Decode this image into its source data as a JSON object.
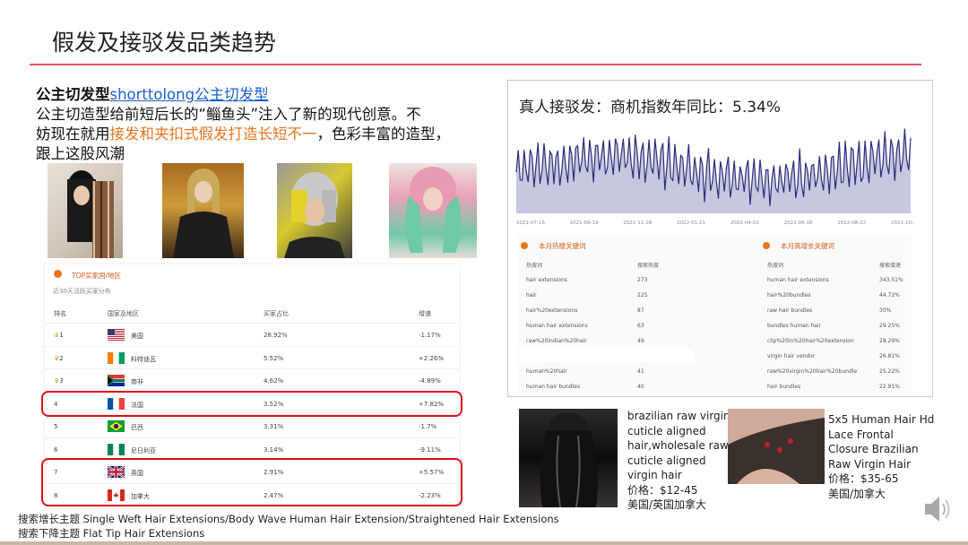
{
  "title": "假发及接驳发品类趋势",
  "intro": {
    "title_bold": "公主切发型",
    "title_link": "shorttolong公主切发型",
    "line1": "公主切造型给前短后长的“鲻鱼头”注入了新的现代创意。不",
    "line2_before": "妨现在就用",
    "line2_highlight": "接发和夹扣式假发打造长短不一",
    "line2_after": "，色彩丰富的造型，",
    "line3": "跟上这股风潮"
  },
  "ranking": {
    "heading": "TOP买家国/地区",
    "subheading": "近30天活跃买家分布",
    "columns": [
      "排名",
      "国家及地区",
      "买家占比",
      "增速"
    ],
    "rows": [
      {
        "rank": "1",
        "crown": true,
        "flag": "us",
        "country": "美国",
        "share": "28.92%",
        "growth": "-1.17%"
      },
      {
        "rank": "2",
        "crown": true,
        "flag": "ci",
        "country": "科特迪瓦",
        "share": "5.52%",
        "growth": "+2.26%"
      },
      {
        "rank": "3",
        "crown": true,
        "flag": "za",
        "country": "南非",
        "share": "4.62%",
        "growth": "-4.89%"
      },
      {
        "rank": "4",
        "crown": false,
        "flag": "fr",
        "country": "法国",
        "share": "3.52%",
        "growth": "+7.82%"
      },
      {
        "rank": "5",
        "crown": false,
        "flag": "br",
        "country": "巴西",
        "share": "3.31%",
        "growth": "-1.7%"
      },
      {
        "rank": "6",
        "crown": false,
        "flag": "ng",
        "country": "尼日利亚",
        "share": "3.14%",
        "growth": "-9.11%"
      },
      {
        "rank": "7",
        "crown": false,
        "flag": "gb",
        "country": "英国",
        "share": "2.91%",
        "growth": "+5.57%"
      },
      {
        "rank": "8",
        "crown": false,
        "flag": "ca",
        "country": "加拿大",
        "share": "2.47%",
        "growth": "-2.23%"
      }
    ]
  },
  "trend": {
    "title": "真人接驳发：商机指数年同比：5.34%",
    "x_ticks": [
      "2021-07-16",
      "2021-09-19",
      "2021-11-28",
      "2022-01-21",
      "2022-04-02",
      "2022-06-16",
      "2022-08-22",
      "2022-10-29"
    ]
  },
  "hot_keywords": {
    "heading": "本月热搜关键词",
    "col1": "热搜词",
    "col2": "搜索热度",
    "rows": [
      {
        "term": "hair extensions",
        "value": "273"
      },
      {
        "term": "hair",
        "value": "225"
      },
      {
        "term": "hair%20extensions",
        "value": "87"
      },
      {
        "term": "human hair extensions",
        "value": "63"
      },
      {
        "term": "raw%20indian%20hair",
        "value": "49"
      },
      {
        "term": "human%20hair",
        "value": "41"
      },
      {
        "term": "human hair bundles",
        "value": "40"
      }
    ]
  },
  "growth_keywords": {
    "heading": "本月高增长关键词",
    "col1": "热搜词",
    "col2": "搜索增速",
    "rows": [
      {
        "term": "human hair extensions",
        "value": "343.51%"
      },
      {
        "term": "hair%20bundles",
        "value": "44.72%"
      },
      {
        "term": "raw hair bundles",
        "value": "30%"
      },
      {
        "term": "bundles human hair",
        "value": "29.25%"
      },
      {
        "term": "clip%20in%20hair%20extension",
        "value": "28.29%"
      },
      {
        "term": "virgin hair vendor",
        "value": "26.81%"
      },
      {
        "term": "raw%20virgin%20hair%20bundle",
        "value": "25.22%"
      },
      {
        "term": "hair bundles",
        "value": "22.91%"
      }
    ]
  },
  "products": [
    {
      "lines": [
        "brazilian raw virgin",
        "cuticle aligned",
        "hair,wholesale raw",
        "cuticle aligned",
        "virgin hair",
        "价格：$12-45",
        "美国/英国加拿大"
      ]
    },
    {
      "lines": [
        "5x5 Human Hair Hd",
        "Lace Frontal",
        "Closure Brazilian",
        "Raw Virgin Hair",
        "价格：$35-65",
        "美国/加拿大"
      ]
    }
  ],
  "footer": {
    "line1": "搜索增长主题 Single Weft Hair Extensions/Body Wave Human Hair Extension/Straightened Hair Extensions",
    "line2": "搜索下降主题 Flat Tip Hair Extensions"
  },
  "colors": {
    "accent_red": "#e0555c",
    "highlight_orange": "#e8741e",
    "link_blue": "#1a5fd0",
    "box_red": "#e0101a",
    "chart_line": "#2d2d7a",
    "chart_fill": "#c5c8df"
  },
  "icons": [
    "crown-icon",
    "flag-icon",
    "speaker-icon"
  ]
}
